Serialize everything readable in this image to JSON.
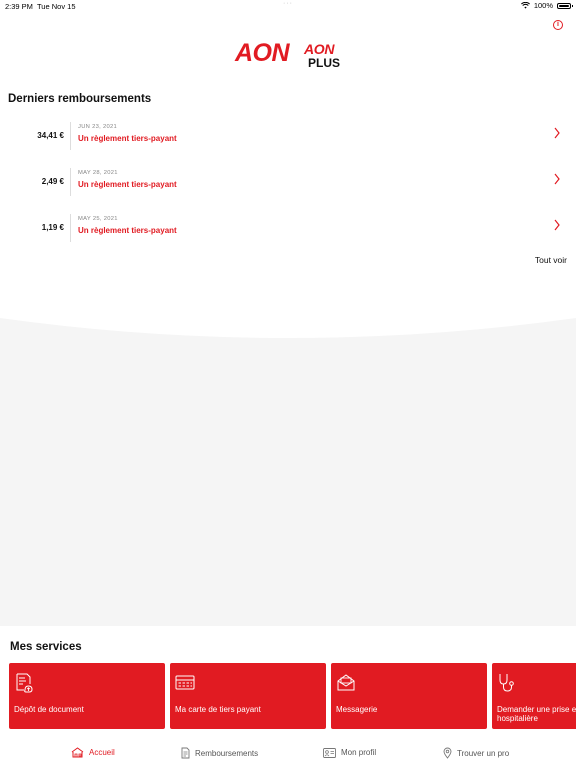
{
  "status_bar": {
    "time": "2:39 PM",
    "date": "Tue Nov 15",
    "battery": "100%"
  },
  "header": {
    "info_icon": "info-circle-icon",
    "logo_main": "AON",
    "logo_sub": "AON",
    "logo_plus": "PLUS"
  },
  "reimbursements": {
    "title": "Derniers remboursements",
    "see_all": "Tout voir",
    "items": [
      {
        "amount": "34,41 €",
        "date": "JUN 23, 2021",
        "label": "Un règlement tiers-payant"
      },
      {
        "amount": "2,49 €",
        "date": "MAY 28, 2021",
        "label": "Un règlement tiers-payant"
      },
      {
        "amount": "1,19 €",
        "date": "MAY 25, 2021",
        "label": "Un règlement tiers-payant"
      }
    ]
  },
  "services": {
    "title": "Mes services",
    "cards": [
      {
        "label": "Dépôt de document",
        "icon": "document-upload-icon"
      },
      {
        "label": "Ma carte de tiers payant",
        "icon": "card-icon"
      },
      {
        "label": "Messagerie",
        "icon": "mail-icon"
      },
      {
        "label": "Demander une prise e",
        "label2": "hospitalière",
        "icon": "stethoscope-icon"
      }
    ]
  },
  "tabbar": {
    "items": [
      {
        "label": "Accueil",
        "icon": "home-icon",
        "active": true
      },
      {
        "label": "Remboursements",
        "icon": "receipt-icon",
        "active": false
      },
      {
        "label": "Mon profil",
        "icon": "profile-card-icon",
        "active": false
      },
      {
        "label": "Trouver un pro",
        "icon": "location-pin-icon",
        "active": false
      }
    ]
  },
  "colors": {
    "brand": "#e11b22",
    "background_grey": "#f5f5f5"
  }
}
